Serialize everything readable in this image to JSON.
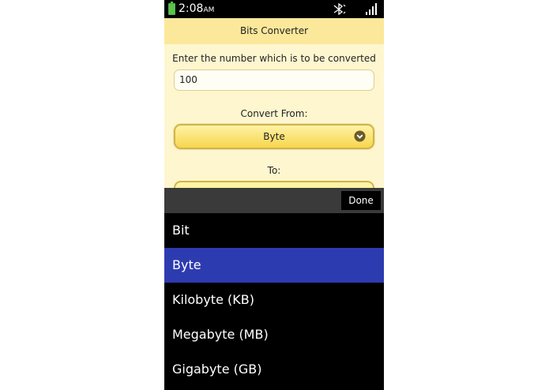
{
  "status_bar": {
    "time": "2:08",
    "ampm": "AM",
    "icons": [
      "battery-icon",
      "mute-icon",
      "signal-icon"
    ],
    "battery_color": "#5cc24a"
  },
  "app": {
    "title": "Bits Converter",
    "prompt_label": "Enter the number which is to be converted",
    "number_value": "100",
    "from_label": "Convert From:",
    "from_value": "Byte",
    "to_label": "To:",
    "accent_color": "#fbe89a"
  },
  "picker": {
    "done_label": "Done",
    "options": [
      {
        "label": "Bit",
        "selected": false
      },
      {
        "label": "Byte",
        "selected": true
      },
      {
        "label": "Kilobyte (KB)",
        "selected": false
      },
      {
        "label": "Megabyte (MB)",
        "selected": false
      },
      {
        "label": "Gigabyte (GB)",
        "selected": false
      }
    ],
    "selected_color": "#2d3bb0"
  }
}
